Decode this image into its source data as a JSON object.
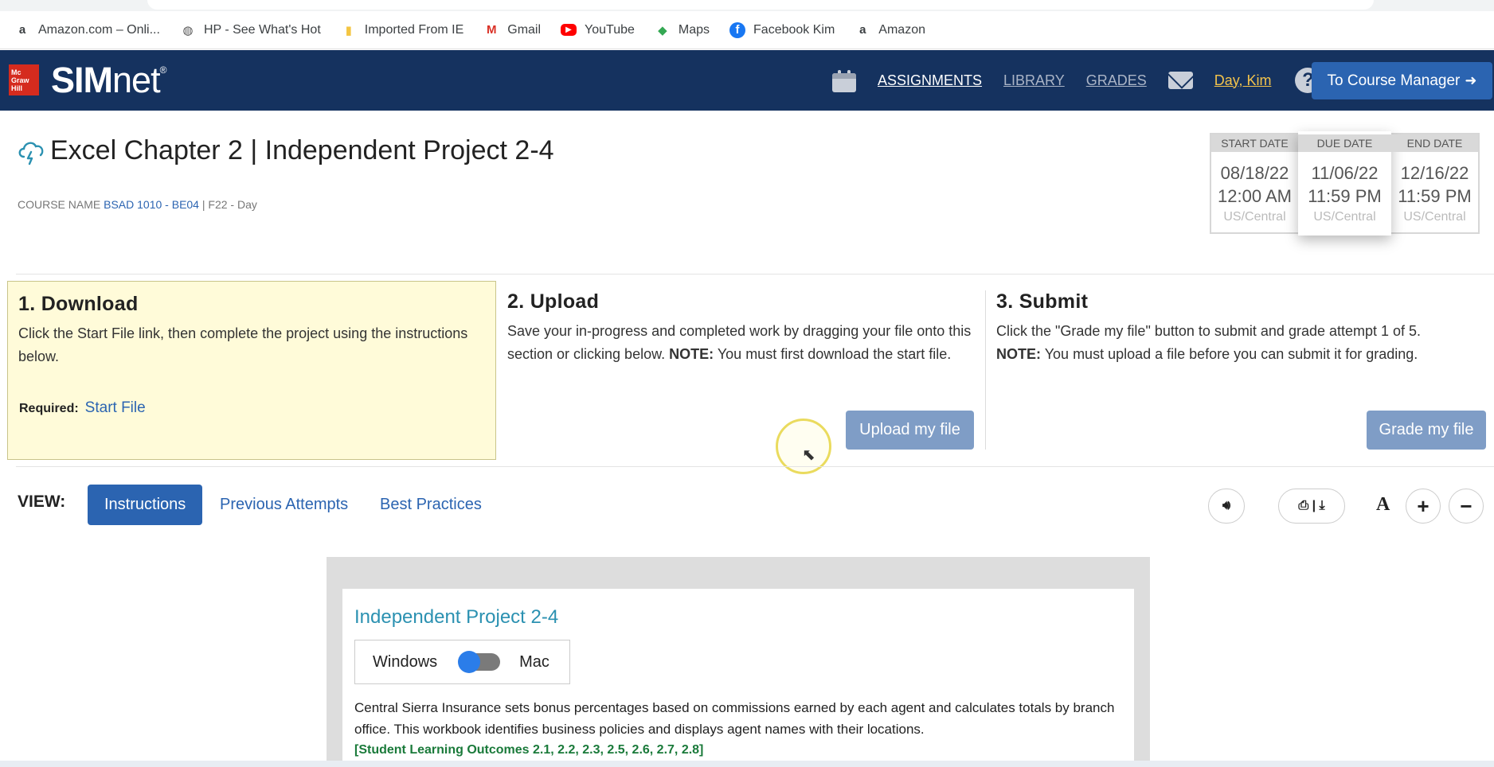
{
  "bookmarks": [
    {
      "label": "Amazon.com – Onli...",
      "icon": "amazon-icon"
    },
    {
      "label": "HP - See What's Hot",
      "icon": "globe-icon"
    },
    {
      "label": "Imported From IE",
      "icon": "folder-icon"
    },
    {
      "label": "Gmail",
      "icon": "gmail-icon"
    },
    {
      "label": "YouTube",
      "icon": "youtube-icon"
    },
    {
      "label": "Maps",
      "icon": "maps-icon"
    },
    {
      "label": "Facebook Kim",
      "icon": "facebook-icon"
    },
    {
      "label": "Amazon",
      "icon": "amazon-icon"
    }
  ],
  "header": {
    "logo_text": "Mc Graw Hill",
    "brand_bold": "SIM",
    "brand_light": "net",
    "brand_reg": "®",
    "nav": {
      "assignments": "ASSIGNMENTS",
      "library": "LIBRARY",
      "grades": "GRADES"
    },
    "user": "Day, Kim",
    "help": "?",
    "course_manager": "To Course Manager"
  },
  "assignment": {
    "title": "Excel Chapter 2 | Independent Project 2-4",
    "course_label": "COURSE NAME",
    "course_code": "BSAD 1010 - BE04",
    "course_term": "| F22 - Day"
  },
  "dates": {
    "start": {
      "label": "START DATE",
      "date": "08/18/22",
      "time": "12:00 AM",
      "tz": "US/Central"
    },
    "due": {
      "label": "DUE DATE",
      "date": "11/06/22",
      "time": "11:59 PM",
      "tz": "US/Central"
    },
    "end": {
      "label": "END DATE",
      "date": "12/16/22",
      "time": "11:59 PM",
      "tz": "US/Central"
    }
  },
  "steps": {
    "download": {
      "title": "1. Download",
      "text": "Click the Start File link, then complete the project using the instructions below.",
      "required_label": "Required:",
      "start_file": "Start File"
    },
    "upload": {
      "title": "2. Upload",
      "text": "Save your in-progress and completed work by dragging your file onto this section or clicking below.",
      "note_label": "NOTE:",
      "note": "You must first download the start file.",
      "button": "Upload my file"
    },
    "submit": {
      "title": "3. Submit",
      "text": "Click the \"Grade my file\" button to submit and grade attempt 1 of 5.",
      "note_label": "NOTE:",
      "note": "You must upload a file before you can submit it for grading.",
      "button": "Grade my file"
    }
  },
  "view": {
    "label": "VIEW:",
    "tabs": [
      "Instructions",
      "Previous Attempts",
      "Best Practices"
    ],
    "active_tab": "Instructions",
    "font_label": "A"
  },
  "instructions": {
    "title": "Independent Project 2-4",
    "os_left": "Windows",
    "os_right": "Mac",
    "os_selected": "Windows",
    "body": "Central Sierra Insurance sets bonus percentages based on commissions earned by each agent and calculates totals by branch office. This workbook identifies business policies and displays agent names with their locations.",
    "outcomes": "[Student Learning Outcomes 2.1, 2.2, 2.3, 2.5, 2.6, 2.7, 2.8]"
  },
  "colors": {
    "header_bg": "#15325f",
    "accent": "#2b64b1",
    "muted_button": "#7f9dc6",
    "download_bg": "#fffbd9",
    "user_link": "#f3c34b"
  }
}
